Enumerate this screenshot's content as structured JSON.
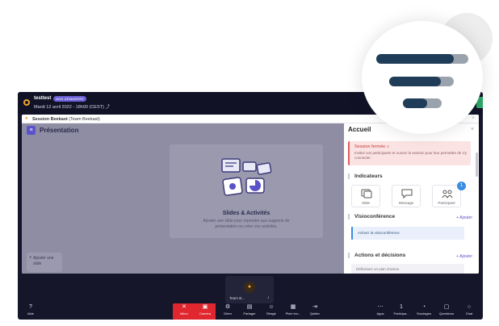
{
  "topbar": {
    "title": "testtest",
    "badge": "NON DÉMARRÉE",
    "date": "Mardi 12 avril 2022 - 18h00 (CEST)  ⤴"
  },
  "session": {
    "window_title_main": "Session Beekast",
    "window_title_team": "(Team Beekast)"
  },
  "left": {
    "title": "Présentation",
    "card_title": "Slides & Activités",
    "card_desc": "Ajouter une slide pour répondre aux supports de présentation ou créer vos activités.",
    "add_slide": "Ajouter une slide"
  },
  "right": {
    "title": "Accueil",
    "closed_title": "Session fermée  ⌂",
    "closed_desc": "Invitez vos participants et ouvrez la session pour leur permettre de s'y connecter.",
    "indicators_title": "Indicateurs",
    "indicators": [
      {
        "label": "Slide"
      },
      {
        "label": "Message"
      },
      {
        "label": "Participant"
      }
    ],
    "notif_count": "1",
    "visio_title": "Visioconférence",
    "visio_add": "+ Ajouter",
    "visio_action": "Activez la visioconférence",
    "actions_title": "Actions et décisions",
    "actions_add": "+ Ajouter",
    "actions_placeholder": "Définissez un plan d'action"
  },
  "camera": {
    "name": "Team B..."
  },
  "toolbar": {
    "left": [
      {
        "label": "Aide",
        "icon": "help-icon"
      }
    ],
    "center": [
      {
        "label": "Micro",
        "icon": "mic-off-icon"
      },
      {
        "label": "Caméra",
        "icon": "camera-off-icon"
      },
      {
        "label": "Gérer",
        "icon": "gear-icon"
      },
      {
        "label": "Partager",
        "icon": "share-icon"
      },
      {
        "label": "Réagir",
        "icon": "emoji-icon"
      },
      {
        "label": "Plein écr...",
        "icon": "fullscreen-icon"
      },
      {
        "label": "Quitter",
        "icon": "exit-icon"
      }
    ],
    "right": [
      {
        "label": "Apps",
        "icon": "more-icon"
      },
      {
        "label": "Participa...",
        "icon": "people-icon",
        "count": "1"
      },
      {
        "label": "Sondages",
        "icon": "poll-icon"
      },
      {
        "label": "Questions",
        "icon": "question-icon"
      },
      {
        "label": "Chat",
        "icon": "chat-icon"
      }
    ]
  },
  "colors": {
    "accent": "#5a52c9",
    "danger": "#e0262e",
    "bar_dark": "#1f3d58",
    "bar_light": "#9aa3ad"
  },
  "bubble_icon": "hamburger-menu-icon"
}
